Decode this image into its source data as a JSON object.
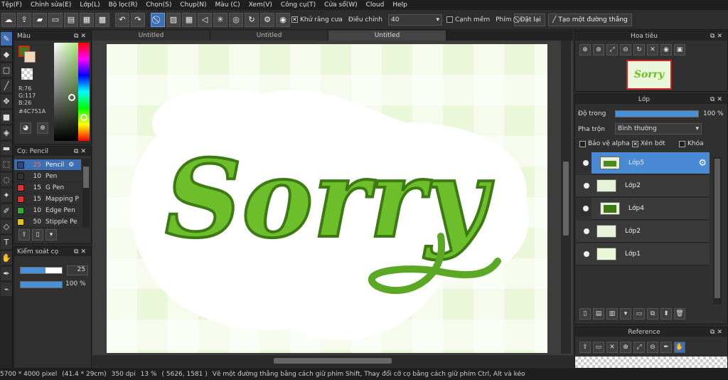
{
  "menu": [
    "Tệp(F)",
    "Chỉnh sửa(E)",
    "Lớp(L)",
    "Bộ lọc(R)",
    "Chọn(S)",
    "Chụp(N)",
    "Màu (C)",
    "Xem(V)",
    "Công cụ(T)",
    "Cửa sổ(W)",
    "Cloud",
    "Help"
  ],
  "toolbar": {
    "antialias_label": "Khử răng cưa",
    "adjust_label": "Điều chỉnh",
    "adjust_value": "40",
    "edge_label": "Cạnh mềm",
    "key_label": "Phím",
    "reset_label": "Đặt lại",
    "line_label": "Tạo một đường thẳng"
  },
  "color_panel": {
    "title": "Màu",
    "r": "R:76",
    "g": "G:117",
    "b": "B:26",
    "hex": "#4C751A",
    "fg_color": "#4C751A"
  },
  "brush_panel": {
    "title": "Cọ: Pencil",
    "items": [
      {
        "size": "25",
        "name": "Pencil",
        "color": "#2a4a7a"
      },
      {
        "size": "10",
        "name": "Pen",
        "color": "#333333"
      },
      {
        "size": "15",
        "name": "G Pen",
        "color": "#e03030"
      },
      {
        "size": "15",
        "name": "Mapping P",
        "color": "#e03030"
      },
      {
        "size": "10",
        "name": "Edge Pen",
        "color": "#2fb02f"
      },
      {
        "size": "50",
        "name": "Stipple Pe",
        "color": "#e8c020"
      }
    ]
  },
  "brush_control": {
    "title": "Kiểm soát cọ",
    "size_value": "25",
    "opacity_value": "100 %",
    "size_fraction": 0.6,
    "opacity_fraction": 1.0
  },
  "tabs": [
    "Untitled",
    "Untitled",
    "Untitled"
  ],
  "canvas": {
    "artwork_text": "Sorry",
    "bg_color": "#eaf7d9",
    "lettering_color": "#6cbf2a"
  },
  "navigator": {
    "title": "Hoa tiêu",
    "thumb_text": "Sorry"
  },
  "layers_panel": {
    "title": "Lớp",
    "opacity_label": "Độ trong",
    "opacity_value": "100 %",
    "opacity_fraction": 1.0,
    "blend_label": "Pha trộn",
    "blend_value": "Bình thường",
    "protect_alpha_label": "Bảo vệ alpha",
    "clipping_label": "Xén bớt",
    "lock_label": "Khóa",
    "layers": [
      {
        "name": "Lớp5",
        "selected": true,
        "indent": true
      },
      {
        "name": "Lớp2",
        "selected": false,
        "indent": false
      },
      {
        "name": "Lớp4",
        "selected": false,
        "indent": true
      },
      {
        "name": "Lớp2",
        "selected": false,
        "indent": false
      },
      {
        "name": "Lớp1",
        "selected": false,
        "indent": false
      }
    ]
  },
  "reference": {
    "title": "Reference"
  },
  "status": {
    "size": "5700 * 4000 pixel",
    "cm": "(41.4 * 29cm)",
    "dpi": "350 dpi",
    "zoom": "13 %",
    "coords": "( 5626, 1581 )",
    "hint": "Vẽ một đường thẳng bằng cách giữ phím Shift, Thay đổi cỡ cọ bằng cách giữ phím Ctrl, Alt và kéo"
  }
}
